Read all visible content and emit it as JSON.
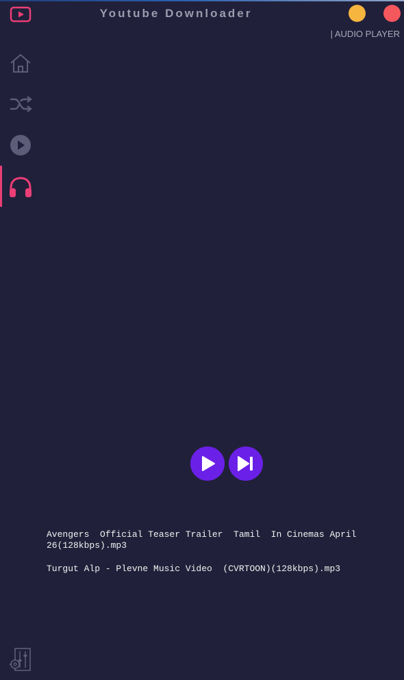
{
  "window": {
    "title": "Youtube Downloader",
    "section_label": "| AUDIO PLAYER"
  },
  "sidebar": {
    "items": [
      {
        "name": "home",
        "icon": "home-icon",
        "active": false
      },
      {
        "name": "shuffle",
        "icon": "shuffle-icon",
        "active": false
      },
      {
        "name": "video",
        "icon": "play-circle-icon",
        "active": false
      },
      {
        "name": "audio",
        "icon": "headphones-icon",
        "active": true
      }
    ],
    "settings_icon": "equalizer-settings-icon"
  },
  "player": {
    "play_icon": "play-icon",
    "next_icon": "skip-next-icon"
  },
  "tracks": [
    "Avengers  Official Teaser Trailer  Tamil  In Cinemas April 26(128kbps).mp3",
    "Turgut Alp - Plevne Music Video  (CVRTOON)(128kbps).mp3"
  ],
  "colors": {
    "background": "#21203a",
    "accent_pink": "#ea3e76",
    "control_purple": "#6b20e8",
    "minimize": "#f6b53f",
    "close": "#f4585d"
  }
}
